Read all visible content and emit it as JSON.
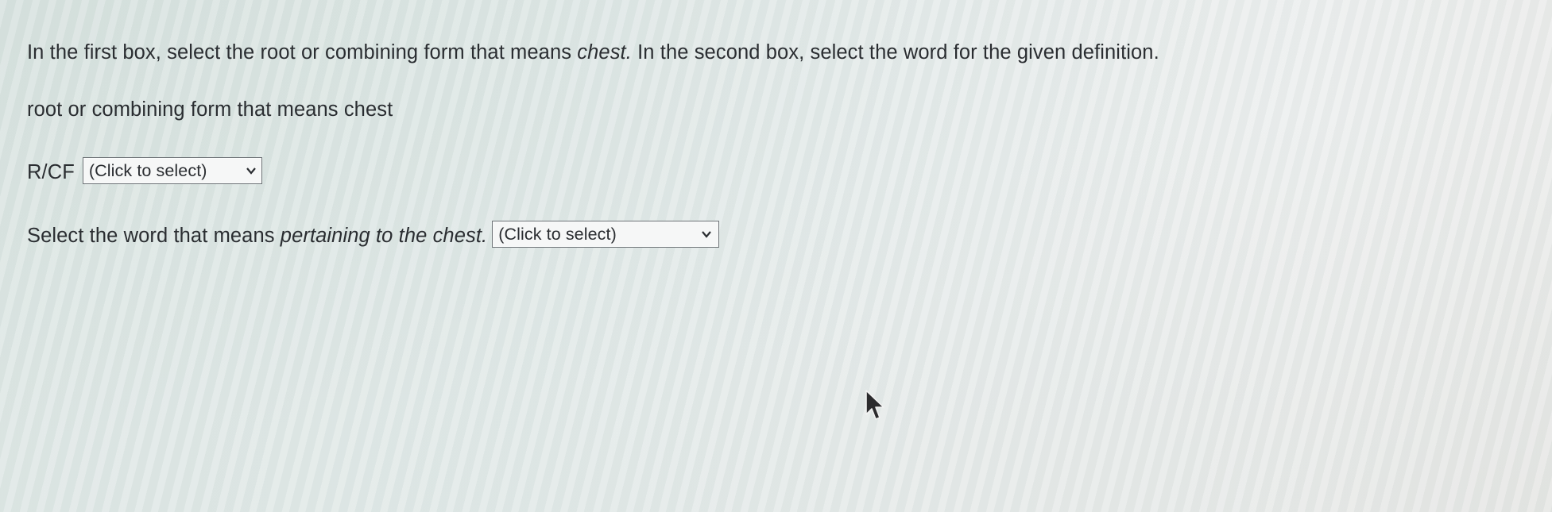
{
  "question": {
    "instruction_part1": "In the first box, select the root or combining form that means ",
    "instruction_emph": "chest.",
    "instruction_part2": " In the second box, select the word for the given definition.",
    "subheading": "root or combining form that means chest",
    "rcf_label": "R/CF",
    "rcf_select_value": "(Click to select)",
    "word_prompt_part1": "Select the word that means ",
    "word_prompt_emph": "pertaining to the chest.",
    "word_select_value": "(Click to select)"
  },
  "icons": {
    "select_arrow": "chevron-down-icon",
    "pointer": "mouse-cursor-icon"
  },
  "colors": {
    "text": "#2a2d31",
    "select_border": "#6d7276",
    "select_background": "#f6f7f7",
    "page_background": "#e3eae9"
  }
}
